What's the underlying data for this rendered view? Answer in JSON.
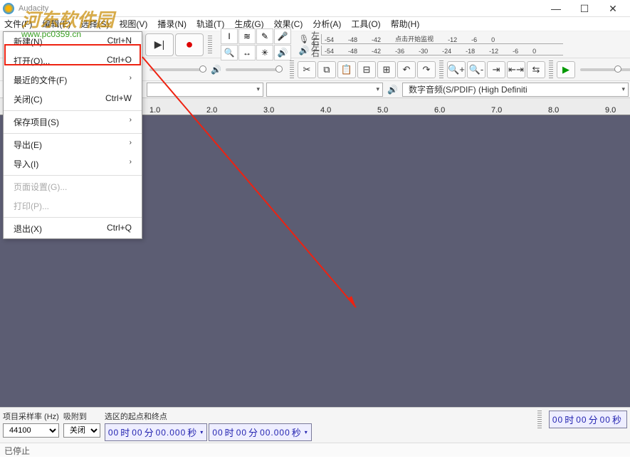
{
  "title": "Audacity",
  "watermark": {
    "line1": "河东软件园",
    "line2": "www.pc0359.cn"
  },
  "menubar": [
    "文件(F)",
    "编辑(E)",
    "选择(S)",
    "视图(V)",
    "播录(N)",
    "轨道(T)",
    "生成(G)",
    "效果(C)",
    "分析(A)",
    "工具(O)",
    "帮助(H)"
  ],
  "dropdown": [
    {
      "label": "新建(N)",
      "shortcut": "Ctrl+N",
      "disabled": false
    },
    {
      "label": "打开(O)...",
      "shortcut": "Ctrl+O",
      "disabled": false,
      "highlight": true
    },
    {
      "label": "最近的文件(F)",
      "shortcut": "",
      "sub": true,
      "disabled": false
    },
    {
      "label": "关闭(C)",
      "shortcut": "Ctrl+W",
      "disabled": false
    },
    {
      "sep": true
    },
    {
      "label": "保存项目(S)",
      "shortcut": "",
      "sub": true,
      "disabled": false
    },
    {
      "sep": true
    },
    {
      "label": "导出(E)",
      "shortcut": "",
      "sub": true,
      "disabled": false
    },
    {
      "label": "导入(I)",
      "shortcut": "",
      "sub": true,
      "disabled": false
    },
    {
      "sep": true
    },
    {
      "label": "页面设置(G)...",
      "shortcut": "",
      "disabled": true
    },
    {
      "label": "打印(P)...",
      "shortcut": "",
      "disabled": true
    },
    {
      "sep": true
    },
    {
      "label": "退出(X)",
      "shortcut": "Ctrl+Q",
      "disabled": false
    }
  ],
  "meter_scale": [
    "-54",
    "-48",
    "-42",
    "-36",
    "-30",
    "-24",
    "-18",
    "-12",
    "-6",
    "0"
  ],
  "meter_hint": "点击开始监视",
  "lr": {
    "l": "左",
    "r": "右"
  },
  "device_out": "数字音频(S/PDIF) (High Definiti",
  "ruler": [
    "1.0",
    "2.0",
    "3.0",
    "4.0",
    "5.0",
    "6.0",
    "7.0",
    "8.0",
    "9.0"
  ],
  "bottom": {
    "sr_label": "项目采样率 (Hz)",
    "sr_value": "44100",
    "snap_label": "吸附到",
    "snap_value": "关闭",
    "sel_label": "选区的起点和终点",
    "t_h": "00",
    "t_m": "00",
    "t_s": "00.000",
    "u_h": "时",
    "u_m": "分",
    "u_s": "秒",
    "big_h": "00",
    "big_m": "00",
    "big_s": "00"
  },
  "status": "已停止"
}
